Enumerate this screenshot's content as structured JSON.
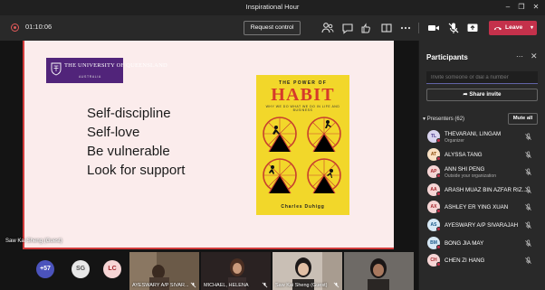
{
  "window": {
    "title": "Inspirational Hour"
  },
  "toolbar": {
    "timer": "01:10:06",
    "request_control": "Request control",
    "leave": "Leave"
  },
  "slide": {
    "logo_name": "THE UNIVERSITY OF QUEENSLAND",
    "logo_sub": "AUSTRALIA",
    "bullets": [
      "Self-discipline",
      "Self-love",
      "Be vulnerable",
      "Look for support"
    ],
    "book": {
      "top": "THE POWER OF",
      "title": "HABIT",
      "subtitle": "WHY WE DO WHAT WE DO IN LIFE AND BUSINESS",
      "author": "Charles Duhigg"
    }
  },
  "stage": {
    "presenter_label": "Saw Kai Sheng (Guest)",
    "round_avatars": [
      {
        "text": "+57",
        "bg": "#4b53bc",
        "fg": "#ffffff"
      },
      {
        "text": "SG",
        "bg": "#e8e8e8",
        "fg": "#555555"
      },
      {
        "text": "LC",
        "bg": "#f6d5d5",
        "fg": "#a4262c"
      }
    ],
    "video_tiles": [
      {
        "label": "AYESWARY A/P SIVAR...",
        "bg": "#6b5a48"
      },
      {
        "label": "MICHAEL, HELENA",
        "bg": "#3a3030"
      },
      {
        "label": "Saw Kai Sheng (Guest)",
        "bg": "#c9bfb5"
      },
      {
        "label": "",
        "bg": "#6e6a66"
      }
    ]
  },
  "participants": {
    "title": "Participants",
    "invite_placeholder": "Invite someone or dial a number",
    "share_invite": "Share invite",
    "presenters_header": "Presenters (62)",
    "mute_all": "Mute all",
    "list": [
      {
        "initials": "TL",
        "name": "THEVARANI, LINGAM",
        "sub": "Organizer",
        "av_bg": "#d9d4ef",
        "av_fg": "#4b3a8c",
        "status": "#c4314b"
      },
      {
        "initials": "AT",
        "name": "ALYSSA TANG",
        "sub": "",
        "av_bg": "#f9e1c4",
        "av_fg": "#8a4b08",
        "status": "#c4314b"
      },
      {
        "initials": "AP",
        "name": "ANN SHI PENG",
        "sub": "Outside your organization",
        "av_bg": "#f6d5d5",
        "av_fg": "#a4262c",
        "status": "#c4314b"
      },
      {
        "initials": "AA",
        "name": "ARASH MUAZ BIN AZFAR RIZ...",
        "sub": "",
        "av_bg": "#f6d5d5",
        "av_fg": "#a4262c",
        "status": "#c4314b"
      },
      {
        "initials": "AX",
        "name": "ASHLEY ER YING XUAN",
        "sub": "",
        "av_bg": "#f6d5d5",
        "av_fg": "#a4262c",
        "status": "#c4314b"
      },
      {
        "initials": "AS",
        "name": "AYESWARY A/P SIVARAJAH",
        "sub": "",
        "av_bg": "#d6e8f5",
        "av_fg": "#1a5a8a",
        "status": "#c4314b"
      },
      {
        "initials": "BM",
        "name": "BONG JIA MAY",
        "sub": "",
        "av_bg": "#d6e8f5",
        "av_fg": "#1a5a8a",
        "status": "#c4314b"
      },
      {
        "initials": "CH",
        "name": "CHEN ZI HANG",
        "sub": "",
        "av_bg": "#f6d5d5",
        "av_fg": "#a4262c",
        "status": "#c4314b"
      }
    ]
  }
}
